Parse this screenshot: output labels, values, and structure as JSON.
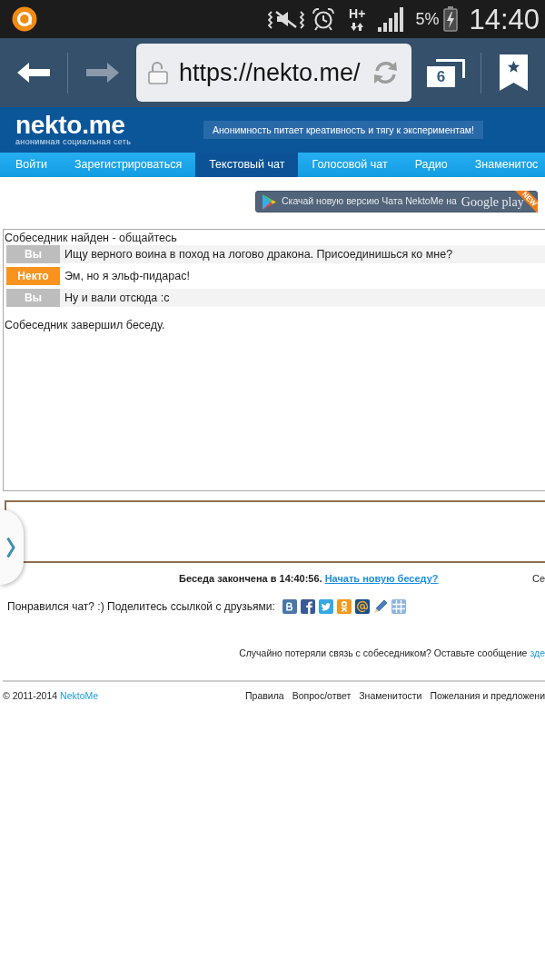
{
  "status_bar": {
    "network_type": "H+",
    "battery_text": "5%",
    "time": "14:40"
  },
  "browser": {
    "url": "https://nekto.me/",
    "tab_count": "6"
  },
  "site_header": {
    "logo": "nekto.me",
    "tagline": "анонимная социальная сеть",
    "slogan": "Анонимность питает креативность и тягу к экспериментам!"
  },
  "nav": [
    {
      "label": "Войти",
      "selected": false
    },
    {
      "label": "Зарегистрироваться",
      "selected": false
    },
    {
      "label": "Текстовый чат",
      "selected": true
    },
    {
      "label": "Голосовой чат",
      "selected": false
    },
    {
      "label": "Радио",
      "selected": false
    },
    {
      "label": "Знаменитос",
      "selected": false
    }
  ],
  "app_banner": {
    "text": "Скачай новую версию Чата NektoMe на",
    "store": "Google play",
    "ribbon": "NEW"
  },
  "chat": {
    "status": "Собеседник найден - общайтесь",
    "messages": [
      {
        "kind": "self",
        "sender": "Вы",
        "text": "Ищу верного воина в поход на логово дракона. Присоединишься ко мне?"
      },
      {
        "kind": "stranger",
        "sender": "Некто",
        "text": "Эм, но я эльф-пидарас!"
      },
      {
        "kind": "self",
        "sender": "Вы",
        "text": "Ну и вали отсюда :с"
      }
    ],
    "end_notice": "Собеседник завершил беседу."
  },
  "conversation_end": {
    "text": "Беседа закончена в 14:40:56.",
    "link": "Начать новую беседу?",
    "right_text": "Се"
  },
  "share": {
    "text": "Понравился чат? :) Поделитесь ссылкой с друзьями:",
    "services": [
      {
        "kind": "vk"
      },
      {
        "kind": "facebook"
      },
      {
        "kind": "twitter"
      },
      {
        "kind": "odnoklassniki"
      },
      {
        "kind": "mail"
      },
      {
        "kind": "pencil"
      },
      {
        "kind": "grid"
      }
    ]
  },
  "reconnect": {
    "text": "Случайно потеряли связь с собеседником? Оставьте сообщение",
    "link": "зде"
  },
  "footer": {
    "copyright": "© 2011-2014",
    "brand_link": "NektoMe",
    "links": [
      "Правила",
      "Вопрос/ответ",
      "Знаменитости",
      "Пожелания и предложени"
    ]
  }
}
